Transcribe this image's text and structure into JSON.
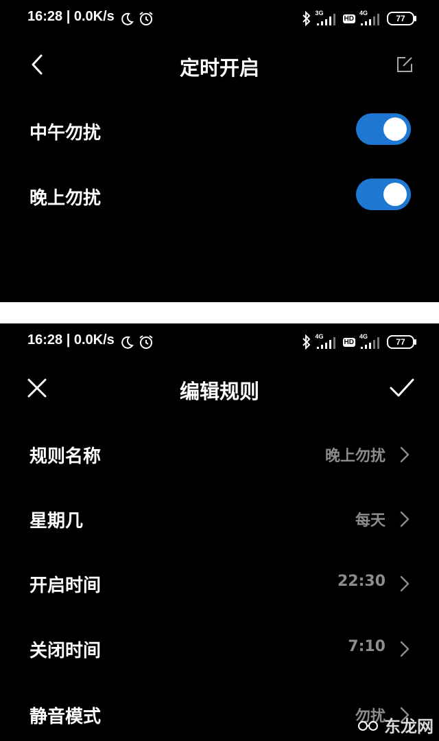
{
  "colors": {
    "background": "#000000",
    "accent": "#1e78d2",
    "secondary_text": "#8c8c8c"
  },
  "top_screen": {
    "status_bar": {
      "time": "16:28 | 0.0K/s",
      "icons": [
        "moon-icon",
        "alarm-icon",
        "bluetooth-icon",
        "signal-3g-icon",
        "hd-icon",
        "signal-4g-icon",
        "battery-icon"
      ],
      "signal1_tag": "3G",
      "hd": "HD",
      "signal2_tag": "4G",
      "battery": "77"
    },
    "header": {
      "title": "定时开启",
      "left_icon": "back-chevron-icon",
      "right_icon": "edit-icon"
    },
    "toggles": [
      {
        "label": "中午勿扰",
        "on": true
      },
      {
        "label": "晚上勿扰",
        "on": true
      }
    ]
  },
  "bottom_screen": {
    "status_bar": {
      "time": "16:28 | 0.0K/s",
      "signal1_tag": "4G",
      "hd": "HD",
      "signal2_tag": "4G",
      "battery": "77"
    },
    "header": {
      "title": "编辑规则",
      "left_icon": "close-icon",
      "right_icon": "check-icon"
    },
    "rules": [
      {
        "label": "规则名称",
        "value": "晚上勿扰"
      },
      {
        "label": "星期几",
        "value": "每天"
      },
      {
        "label": "开启时间",
        "value": "22:30"
      },
      {
        "label": "关闭时间",
        "value": "7:10"
      },
      {
        "label": "静音模式",
        "value": "勿扰"
      }
    ],
    "watermark": "东龙网"
  }
}
